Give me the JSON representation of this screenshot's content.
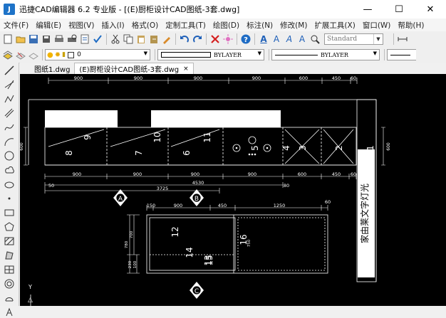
{
  "window": {
    "app_icon_label": "J",
    "title": "迅捷CAD编辑器 6.2 专业版  - [(E)厨柜设计CAD图纸-3套.dwg]",
    "minimize": "—",
    "maximize": "☐",
    "close": "✕"
  },
  "menu": {
    "items": [
      {
        "label": "文件(F)"
      },
      {
        "label": "编辑(E)"
      },
      {
        "label": "视图(V)"
      },
      {
        "label": "插入(I)"
      },
      {
        "label": "格式(O)"
      },
      {
        "label": "定制工具(T)"
      },
      {
        "label": "绘图(D)"
      },
      {
        "label": "标注(N)"
      },
      {
        "label": "修改(M)"
      },
      {
        "label": "扩展工具(X)"
      },
      {
        "label": "窗口(W)"
      },
      {
        "label": "帮助(H)"
      }
    ]
  },
  "toolbar": {
    "text_style": "Standard",
    "text_icon_1": "A",
    "text_icon_2": "A",
    "text_icon_3": "A",
    "text_icon_4": "A"
  },
  "layer": {
    "current": "0",
    "linetype": "BYLAYER",
    "lineweight": "BYLAYER"
  },
  "tabs": [
    {
      "label": "图纸1.dwg",
      "active": false
    },
    {
      "label": "(E)厨柜设计CAD图纸-3套.dwg",
      "active": true
    }
  ],
  "tab_close": "×",
  "drawing": {
    "top_dims": [
      "900",
      "900",
      "900",
      "900",
      "600",
      "450",
      "60"
    ],
    "bottom_dims": [
      "900",
      "900",
      "900",
      "900",
      "600",
      "450",
      "60"
    ],
    "total_dim": "4530",
    "sub_dim": "3725",
    "small_dim_left": "50",
    "small_dim_right": "80",
    "side_dim_left": "600",
    "side_dim_right": "600",
    "cabinet_numbers": [
      "9",
      "8",
      "10",
      "7",
      "11",
      "6",
      "5",
      "4",
      "3",
      "2",
      "1"
    ],
    "section_markers": [
      "A",
      "B",
      "C"
    ],
    "island_top_dims": [
      "150",
      "900",
      "450",
      "1250",
      "60"
    ],
    "island_left_dims": [
      "780",
      "700",
      "230",
      "100"
    ],
    "island_numbers": [
      "12",
      "14",
      "13",
      "15",
      "16"
    ],
    "island_vertical_dim": "750",
    "vertical_note": "家由莱文字灯光",
    "ucs_y": "Y",
    "ucs_arrow": "△"
  }
}
